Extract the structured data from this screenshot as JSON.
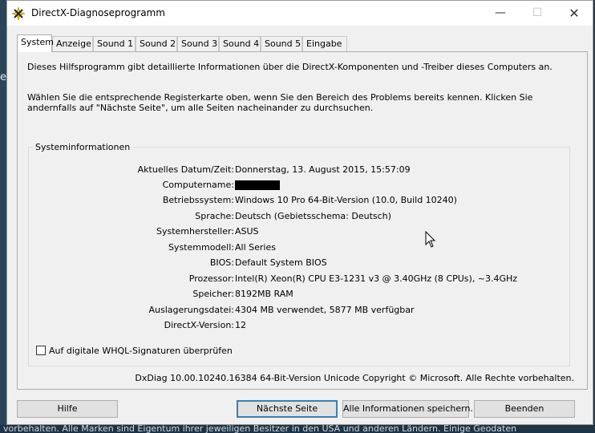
{
  "background": {
    "edge_letter": "e",
    "footer_text": "vorbehalten. Alle Marken sind Eigentum ihrer jeweiligen Besitzer in den USA und anderen Ländern. Einige Geodaten"
  },
  "window": {
    "title": "DirectX-Diagnoseprogramm",
    "app_icon": "directx-icon",
    "controls": {
      "minimize": "—",
      "maximize": "☐",
      "close": "✕"
    }
  },
  "tabs": [
    {
      "label": "System",
      "active": true
    },
    {
      "label": "Anzeige",
      "active": false
    },
    {
      "label": "Sound 1",
      "active": false
    },
    {
      "label": "Sound 2",
      "active": false
    },
    {
      "label": "Sound 3",
      "active": false
    },
    {
      "label": "Sound 4",
      "active": false
    },
    {
      "label": "Sound 5",
      "active": false
    },
    {
      "label": "Eingabe",
      "active": false
    }
  ],
  "intro": {
    "line1": "Dieses Hilfsprogramm gibt detaillierte Informationen über die DirectX-Komponenten und -Treiber dieses Computers an.",
    "line2": "Wählen Sie die entsprechende Registerkarte oben, wenn Sie den Bereich des Problems bereits kennen. Klicken Sie andernfalls auf \"Nächste Seite\", um alle Seiten nacheinander zu durchsuchen."
  },
  "system_info": {
    "group_title": "Systeminformationen",
    "rows": [
      {
        "label": "Aktuelles Datum/Zeit:",
        "value": "Donnerstag, 13. August 2015, 15:57:09"
      },
      {
        "label": "Computername:",
        "value": ""
      },
      {
        "label": "Betriebssystem:",
        "value": "Windows 10 Pro 64-Bit-Version (10.0, Build 10240)"
      },
      {
        "label": "Sprache:",
        "value": "Deutsch (Gebietsschema: Deutsch)"
      },
      {
        "label": "Systemhersteller:",
        "value": "ASUS"
      },
      {
        "label": "Systemmodell:",
        "value": "All Series"
      },
      {
        "label": "BIOS:",
        "value": "Default System BIOS"
      },
      {
        "label": "Prozessor:",
        "value": "Intel(R) Xeon(R) CPU E3-1231 v3 @ 3.40GHz (8 CPUs), ~3.4GHz"
      },
      {
        "label": "Speicher:",
        "value": "8192MB RAM"
      },
      {
        "label": "Auslagerungsdatei:",
        "value": "4304 MB verwendet, 5877 MB verfügbar"
      },
      {
        "label": "DirectX-Version:",
        "value": "12"
      }
    ],
    "whql_checkbox": {
      "label": "Auf digitale WHQL-Signaturen überprüfen",
      "checked": false
    }
  },
  "copyright": "DxDiag 10.00.10240.16384 64-Bit-Version Unicode Copyright © Microsoft. Alle Rechte vorbehalten.",
  "buttons": {
    "help": "Hilfe",
    "next_page": "Nächste Seite",
    "save_all": "Alle Informationen speichern...",
    "exit": "Beenden"
  }
}
